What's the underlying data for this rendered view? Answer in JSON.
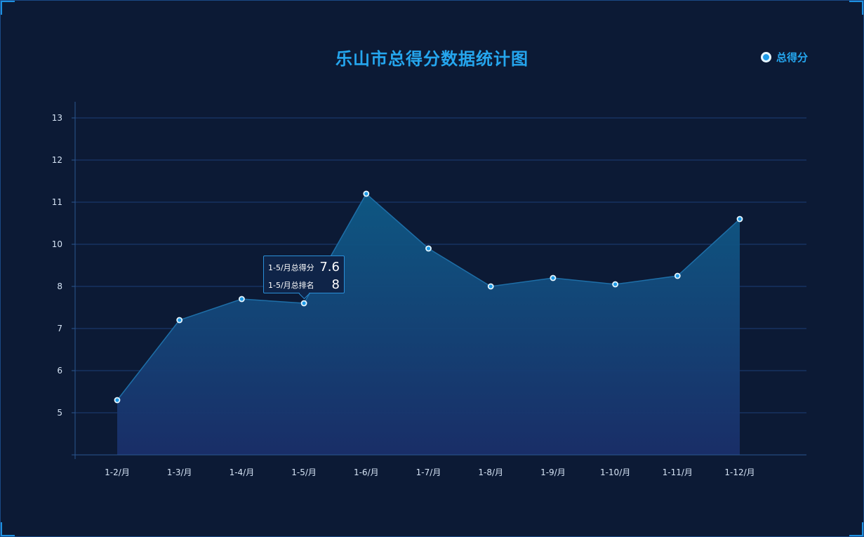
{
  "chart_data": {
    "type": "area",
    "title": "乐山市总得分数据统计图",
    "legend": {
      "label": "总得分",
      "placement": "top-right"
    },
    "categories": [
      "1-2/月",
      "1-3/月",
      "1-4/月",
      "1-5/月",
      "1-6/月",
      "1-7/月",
      "1-8/月",
      "1-9/月",
      "1-10/月",
      "1-11/月",
      "1-12/月"
    ],
    "y_ticks": [
      "5",
      "6",
      "7",
      "8",
      "10",
      "11",
      "12",
      "13"
    ],
    "series": [
      {
        "name": "总得分",
        "values": [
          5.3,
          7.2,
          7.7,
          7.6,
          11.2,
          9.8,
          8,
          8.4,
          8.1,
          8.5,
          10.6
        ]
      }
    ],
    "grid": true,
    "colors": {
      "accent": "#25a6ee",
      "line": "#1e6fa8",
      "point_fill": "#1e9be8",
      "point_stroke": "#e6f6ff"
    },
    "tooltip": {
      "category": "1-5/月",
      "rows": [
        {
          "label": "1-5/月总得分",
          "value": "7.6"
        },
        {
          "label": "1-5/月总排名",
          "value": "8"
        }
      ]
    }
  }
}
